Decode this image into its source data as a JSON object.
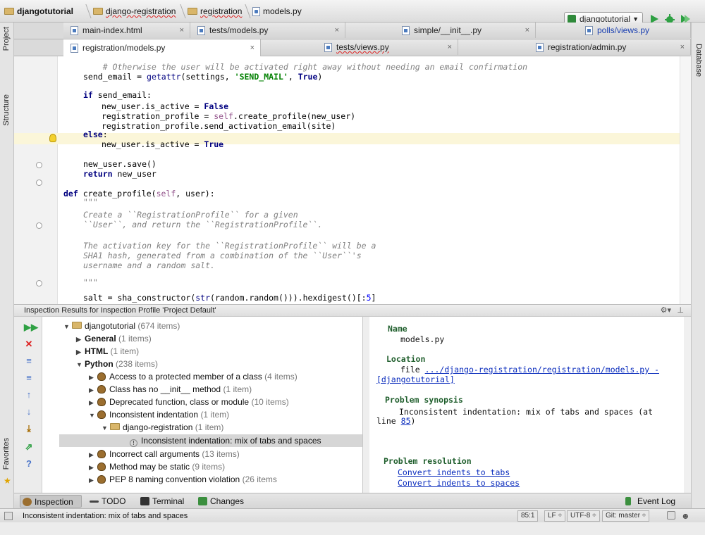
{
  "breadcrumbs": [
    "djangotutorial",
    "django-registration",
    "registration",
    "models.py"
  ],
  "run_config": "djangotutorial",
  "left_strip": {
    "project": "1: Project",
    "structure": "7: Structure",
    "favorites": "2: Favorites"
  },
  "right_strip": {
    "database": "Database"
  },
  "tabs_row1": [
    {
      "label": "main-index.html"
    },
    {
      "label": "tests/models.py"
    },
    {
      "label": "simple/__init__.py"
    },
    {
      "label": "polls/views.py"
    }
  ],
  "tabs_row2": [
    {
      "label": "registration/models.py"
    },
    {
      "label": "tests/views.py"
    },
    {
      "label": "registration/admin.py"
    }
  ],
  "inspection": {
    "title": "Inspection Results for Inspection Profile 'Project Default'",
    "tree": [
      {
        "label": "djangotutorial",
        "count": "(674 items)"
      },
      {
        "label": "General",
        "count": "(1 items)"
      },
      {
        "label": "HTML",
        "count": "(1 item)"
      },
      {
        "label": "Python",
        "count": "(238 items)"
      },
      {
        "label": "Access to a protected member of a class",
        "count": "(4 items)"
      },
      {
        "label": "Class has no __init__ method",
        "count": "(1 item)"
      },
      {
        "label": "Deprecated function, class or module",
        "count": "(10 items)"
      },
      {
        "label": "Inconsistent indentation",
        "count": "(1 item)"
      },
      {
        "label": "django-registration",
        "count": "(1 item)"
      },
      {
        "label": "Inconsistent indentation: mix of tabs and spaces",
        "count": ""
      },
      {
        "label": "Incorrect call arguments",
        "count": "(13 items)"
      },
      {
        "label": "Method may be static",
        "count": "(9 items)"
      },
      {
        "label": "PEP 8 naming convention violation",
        "count": "(26 items"
      }
    ],
    "detail": {
      "name_h": "Name",
      "name_v": "models.py",
      "location_h": "Location",
      "location_prefix": "file",
      "location_link": ".../django-registration/registration/models.py -",
      "location_link2": "[djangotutorial]",
      "synopsis_h": "Problem synopsis",
      "synopsis_v": "Inconsistent indentation: mix of tabs and spaces (at",
      "synopsis_line_prefix": "line",
      "synopsis_line_link": "85",
      "synopsis_line_suffix": ")",
      "resolution_h": "Problem resolution",
      "fix1": "Convert indents to tabs",
      "fix2": "Convert indents to spaces"
    }
  },
  "toolwindows": [
    "Inspection",
    "TODO",
    "Terminal",
    "Changes",
    "Event Log"
  ],
  "status": {
    "message": "Inconsistent indentation: mix of tabs and spaces",
    "position": "85:1",
    "line_sep": "LF ÷",
    "encoding": "UTF-8 ÷",
    "vcs": "Git: master ÷"
  },
  "colors": {
    "keyword": "#000080",
    "string": "#008000",
    "comment": "#808080",
    "self": "#94558d",
    "heading": "#1f5e2c",
    "link": "#0b2dbd"
  }
}
